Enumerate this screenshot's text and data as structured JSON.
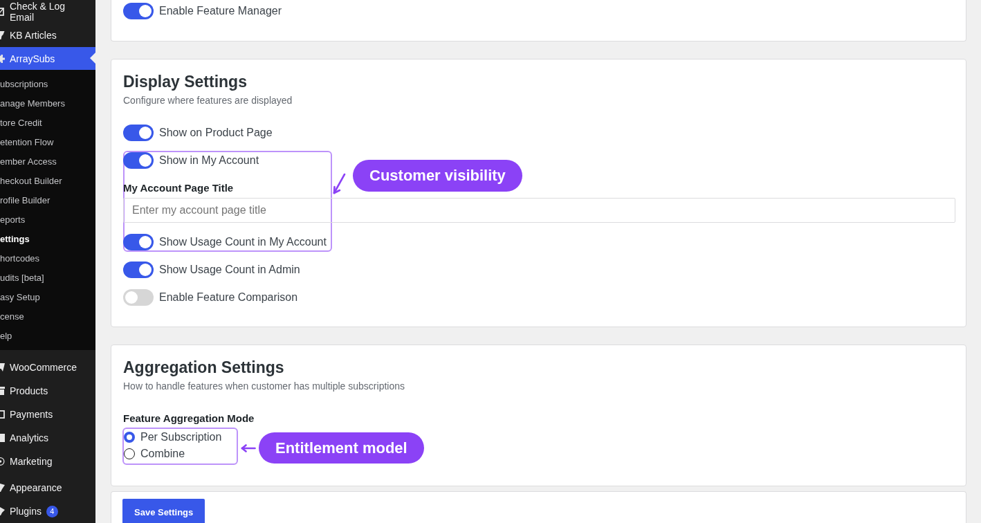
{
  "sidebar": {
    "groups": [
      {
        "items": [
          {
            "label": "Check & Log Email",
            "selected": false
          },
          {
            "label": "KB Articles",
            "selected": false
          },
          {
            "label": "ArraySubs",
            "selected": true,
            "children": [
              {
                "label": "ubscriptions",
                "selected": false
              },
              {
                "label": "anage Members",
                "selected": false
              },
              {
                "label": "tore Credit",
                "selected": false
              },
              {
                "label": "etention Flow",
                "selected": false
              },
              {
                "label": "ember Access",
                "selected": false
              },
              {
                "label": "heckout Builder",
                "selected": false
              },
              {
                "label": "rofile Builder",
                "selected": false
              },
              {
                "label": "eports",
                "selected": false
              },
              {
                "label": "ettings",
                "selected": true
              },
              {
                "label": "hortcodes",
                "selected": false
              },
              {
                "label": "udits [beta]",
                "selected": false
              },
              {
                "label": "asy Setup",
                "selected": false
              },
              {
                "label": "cense",
                "selected": false
              },
              {
                "label": "elp",
                "selected": false
              }
            ]
          }
        ]
      },
      {
        "items": [
          {
            "label": "WooCommerce",
            "selected": false
          },
          {
            "label": "Products",
            "selected": false
          },
          {
            "label": "Payments",
            "selected": false
          },
          {
            "label": "Analytics",
            "selected": false
          },
          {
            "label": "Marketing",
            "selected": false
          }
        ]
      },
      {
        "items": [
          {
            "label": "Appearance",
            "selected": false
          },
          {
            "label": "Plugins",
            "selected": false,
            "badge": "4"
          }
        ]
      }
    ]
  },
  "sections": [
    {
      "fields": [
        {
          "kind": "toggle",
          "label": "Enable Feature Manager",
          "on": true,
          "highlighted": false
        }
      ]
    },
    {
      "title": "Display Settings",
      "subtitle": "Configure where features are displayed",
      "fields": [
        {
          "kind": "toggle",
          "label": "Show on Product Page",
          "on": true,
          "highlighted": false
        },
        {
          "kind": "toggle",
          "label": "Show in My Account",
          "on": true,
          "highlighted": true
        },
        {
          "kind": "text_input",
          "label": "My Account Page Title",
          "placeholder": "Enter my account page title",
          "highlighted": true
        },
        {
          "kind": "toggle",
          "label": "Show Usage Count in My Account",
          "on": true,
          "highlighted": true
        },
        {
          "kind": "toggle",
          "label": "Show Usage Count in Admin",
          "on": true,
          "highlighted": false
        },
        {
          "kind": "toggle",
          "label": "Enable Feature Comparison",
          "on": false,
          "highlighted": false
        }
      ],
      "callout": {
        "kind": "diagonal",
        "label": "Customer visibility"
      }
    },
    {
      "title": "Aggregation Settings",
      "subtitle": "How to handle features when customer has multiple subscriptions",
      "fields": [
        {
          "kind": "radio_group",
          "label": "Feature Aggregation Mode",
          "highlighted": true,
          "options": [
            {
              "label": "Per Subscription",
              "selected": true
            },
            {
              "label": "Combine",
              "selected": false
            }
          ]
        }
      ],
      "callout": {
        "kind": "horizontal",
        "label": "Entitlement model"
      }
    },
    {
      "buttons": [
        {
          "label": "Save Settings"
        }
      ]
    }
  ]
}
